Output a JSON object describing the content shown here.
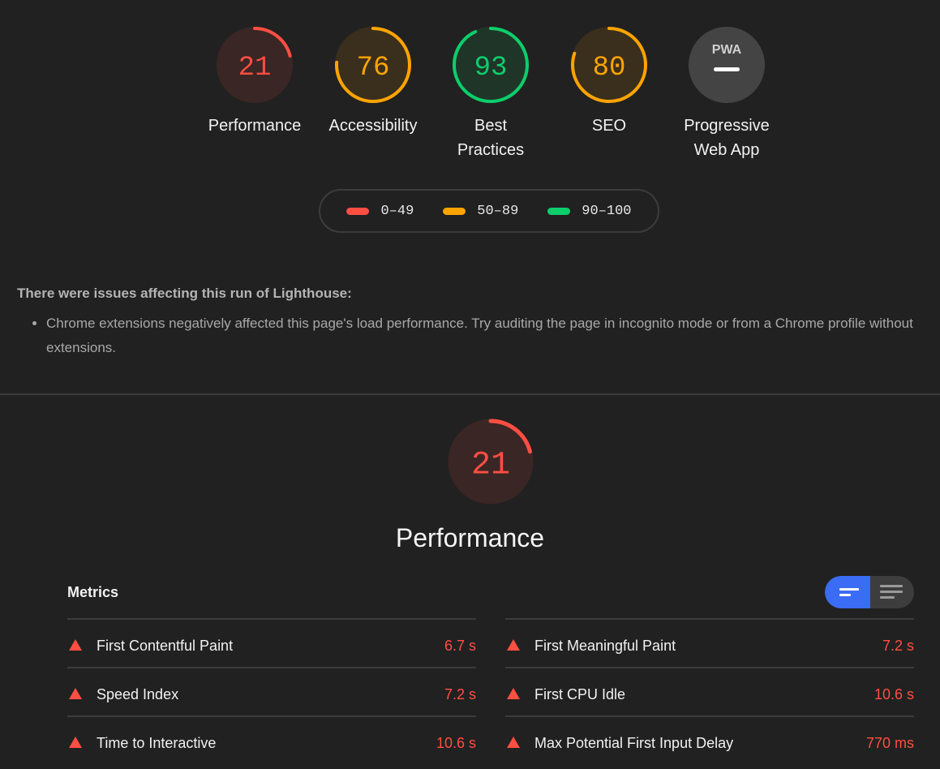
{
  "colors": {
    "fail": "#ff4e42",
    "average": "#ffa400",
    "pass": "#0cce6b",
    "neutral": "#3d3d3d",
    "accent": "#3a6cf5"
  },
  "categories": [
    {
      "score": "21",
      "label": "Performance",
      "level": "fail",
      "fraction": 0.21
    },
    {
      "score": "76",
      "label": "Accessibility",
      "level": "average",
      "fraction": 0.76
    },
    {
      "score": "93",
      "label": "Best Practices",
      "level": "pass",
      "fraction": 0.93
    },
    {
      "score": "80",
      "label": "SEO",
      "level": "average",
      "fraction": 0.8
    },
    {
      "score": "PWA",
      "label": "Progressive Web App",
      "level": "neutral"
    }
  ],
  "legend": [
    {
      "range": "0–49",
      "color": "#ff4e42"
    },
    {
      "range": "50–89",
      "color": "#ffa400"
    },
    {
      "range": "90–100",
      "color": "#0cce6b"
    }
  ],
  "warnings": {
    "title": "There were issues affecting this run of Lighthouse:",
    "items": [
      "Chrome extensions negatively affected this page's load performance. Try auditing the page in incognito mode or from a Chrome profile without extensions."
    ]
  },
  "performance": {
    "score": "21",
    "fraction": 0.21,
    "title": "Performance",
    "metrics_title": "Metrics",
    "toggle": {
      "icons": [
        "metrics-compact-view-icon",
        "metrics-expanded-view-icon"
      ]
    },
    "metrics_left": [
      {
        "name": "First Contentful Paint",
        "value": "6.7 s"
      },
      {
        "name": "Speed Index",
        "value": "7.2 s"
      },
      {
        "name": "Time to Interactive",
        "value": "10.6 s"
      }
    ],
    "metrics_right": [
      {
        "name": "First Meaningful Paint",
        "value": "7.2 s"
      },
      {
        "name": "First CPU Idle",
        "value": "10.6 s"
      },
      {
        "name": "Max Potential First Input Delay",
        "value": "770 ms"
      }
    ]
  }
}
